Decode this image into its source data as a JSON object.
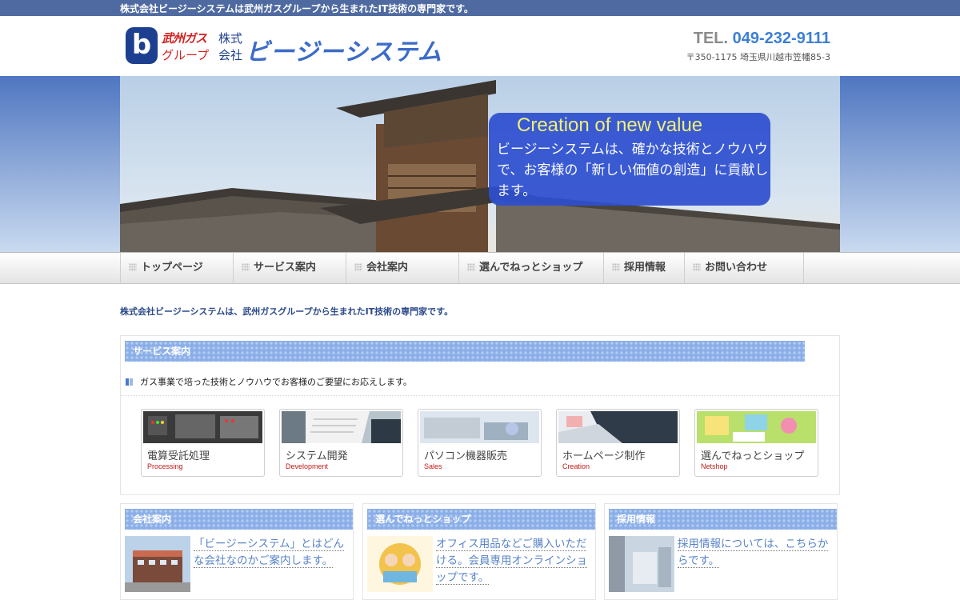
{
  "topbar": {
    "text": "株式会社ビージーシステムは武州ガスグループから生まれたIT技術の専門家です。"
  },
  "header": {
    "logo_mark": "b",
    "logo_group_line1": "武州ガス",
    "logo_group_line2": "グループ",
    "logo_kabu_line1": "株式",
    "logo_kabu_line2": "会社",
    "company_name": "ビージーシステム",
    "tel_label": "TEL.",
    "tel_number": "049-232-9111",
    "address": "〒350-1175 埼玉県川越市笠幡85-3"
  },
  "hero": {
    "title": "Creation of new value",
    "text": "ビージーシステムは、確かな技術とノウハウで、お客様の「新しい価値の創造」に貢献します。"
  },
  "nav": {
    "items": [
      {
        "label": "トップページ"
      },
      {
        "label": "サービス案内"
      },
      {
        "label": "会社案内"
      },
      {
        "label": "選んでねっとショップ"
      },
      {
        "label": "採用情報"
      },
      {
        "label": "お問い合わせ"
      }
    ]
  },
  "intro": {
    "text": "株式会社ビージーシステムは、武州ガスグループから生まれたIT技術の専門家です。"
  },
  "services": {
    "title": "サービス案内",
    "subtitle": "ガス事業で培った技術とノウハウでお客様のご要望にお応えします。",
    "cards": [
      {
        "jp": "電算受託処理",
        "en": "Processing"
      },
      {
        "jp": "システム開発",
        "en": "Development"
      },
      {
        "jp": "パソコン機器販売",
        "en": "Sales"
      },
      {
        "jp": "ホームページ制作",
        "en": "Creation"
      },
      {
        "jp": "選んでねっとショップ",
        "en": "Netshop"
      }
    ]
  },
  "bottom": {
    "company": {
      "title": "会社案内",
      "text": "「ビージーシステム」とはどんな会社なのかご案内します。"
    },
    "shop": {
      "title": "選んでねっとショップ",
      "text": "オフィス用品などご購入いただける。会員専用オンラインショップです。"
    },
    "recruit": {
      "title": "採用情報",
      "text": "採用情報については、こちらからです。"
    }
  },
  "colors": {
    "accent": "#3c6cc8",
    "topbar": "#4f6aa0",
    "bar": "#8aaee8",
    "logo_red": "#d42020"
  }
}
